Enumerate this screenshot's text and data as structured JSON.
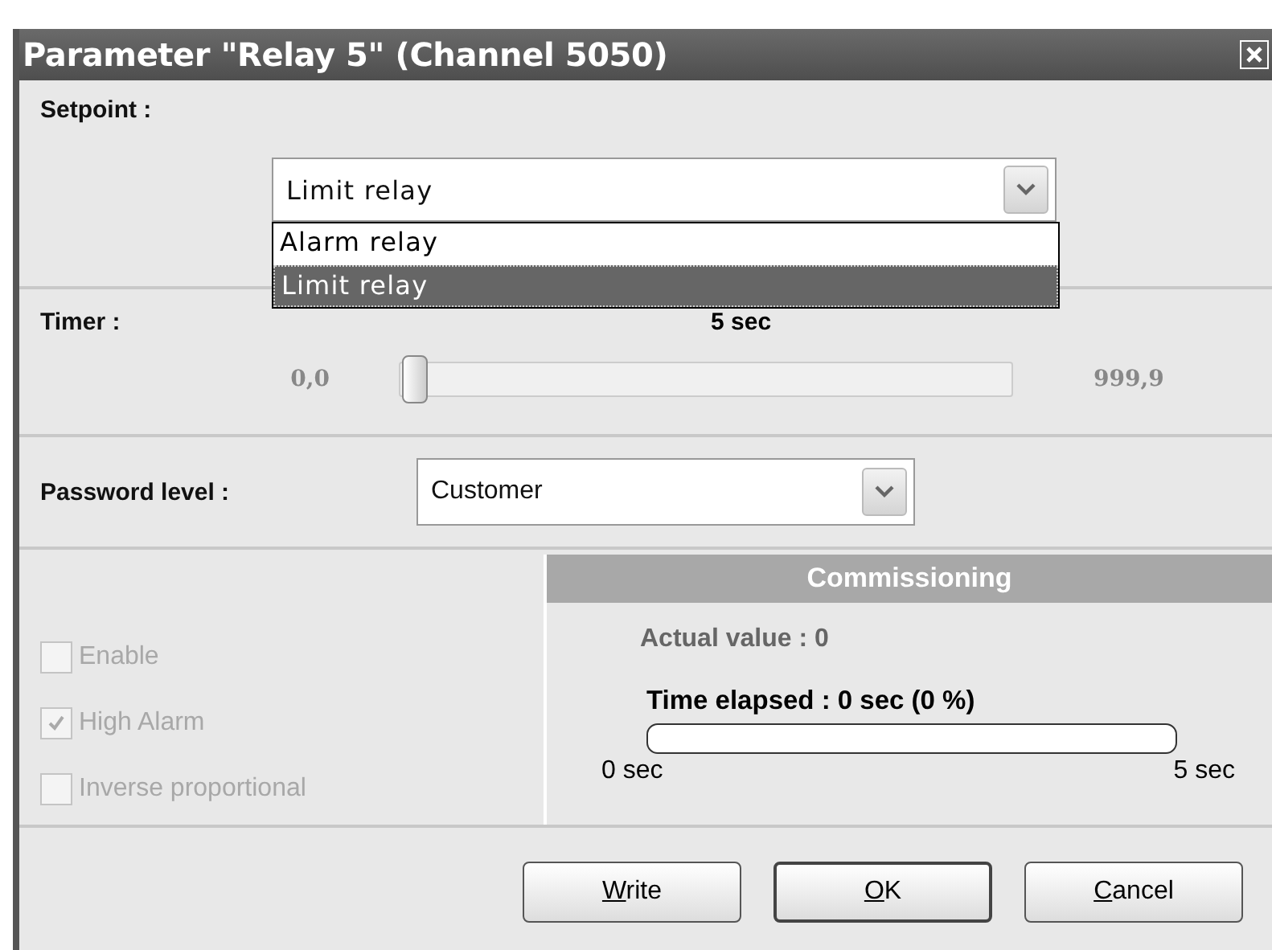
{
  "window": {
    "title": "Parameter \"Relay 5\" (Channel 5050)"
  },
  "setpoint": {
    "label": "Setpoint :",
    "value": "Limit relay",
    "expanded": true,
    "options": [
      {
        "label": "Alarm relay",
        "selected": false
      },
      {
        "label": "Limit relay",
        "selected": true
      }
    ]
  },
  "timer": {
    "label": "Timer :",
    "reading": "5 sec",
    "min": "0,0",
    "max": "999,9",
    "level": 0.005
  },
  "password": {
    "label": "Password level :",
    "value": "Customer"
  },
  "options": [
    {
      "label": "Enable",
      "checked": false,
      "disabled": true
    },
    {
      "label": "High Alarm",
      "checked": true,
      "disabled": true
    },
    {
      "label": "Inverse proportional",
      "checked": false,
      "disabled": true
    }
  ],
  "commissioning": {
    "title": "Commissioning",
    "actual_value": "Actual value : 0",
    "time_elapsed": "Time elapsed : 0 sec (0 %)",
    "level": 0,
    "start": "0 sec",
    "end": "5 sec"
  },
  "buttons": [
    {
      "label": "Write",
      "default": false
    },
    {
      "label": "OK",
      "default": true
    },
    {
      "label": "Cancel",
      "default": false
    }
  ]
}
